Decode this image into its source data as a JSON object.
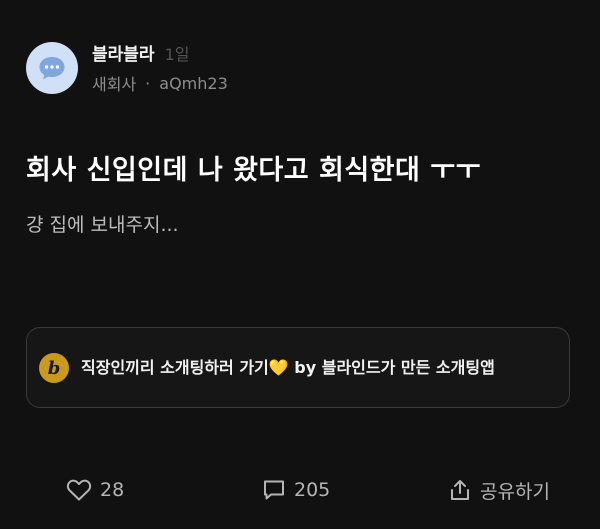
{
  "post": {
    "author": "블라블라",
    "time": "1일",
    "company": "새회사",
    "separator": "·",
    "user_id": "aQmh23",
    "title": "회사 신입인데 나 왔다고 회식한대 ㅜㅜ",
    "body": "걍 집에 보내주지..."
  },
  "promo": {
    "logo_letter": "b",
    "text": "직장인끼리 소개팅하러 가기💛 by 블라인드가 만든 소개팅앱"
  },
  "actions": {
    "likes": "28",
    "comments": "205",
    "share_label": "공유하기"
  },
  "colors": {
    "background": "#111111",
    "avatar_bg": "#cfe0f7",
    "avatar_icon": "#7fa6dd",
    "promo_logo": "#c99a1e"
  },
  "icons": [
    "chat-bubble-icon",
    "heart-icon",
    "comment-icon",
    "share-icon"
  ]
}
